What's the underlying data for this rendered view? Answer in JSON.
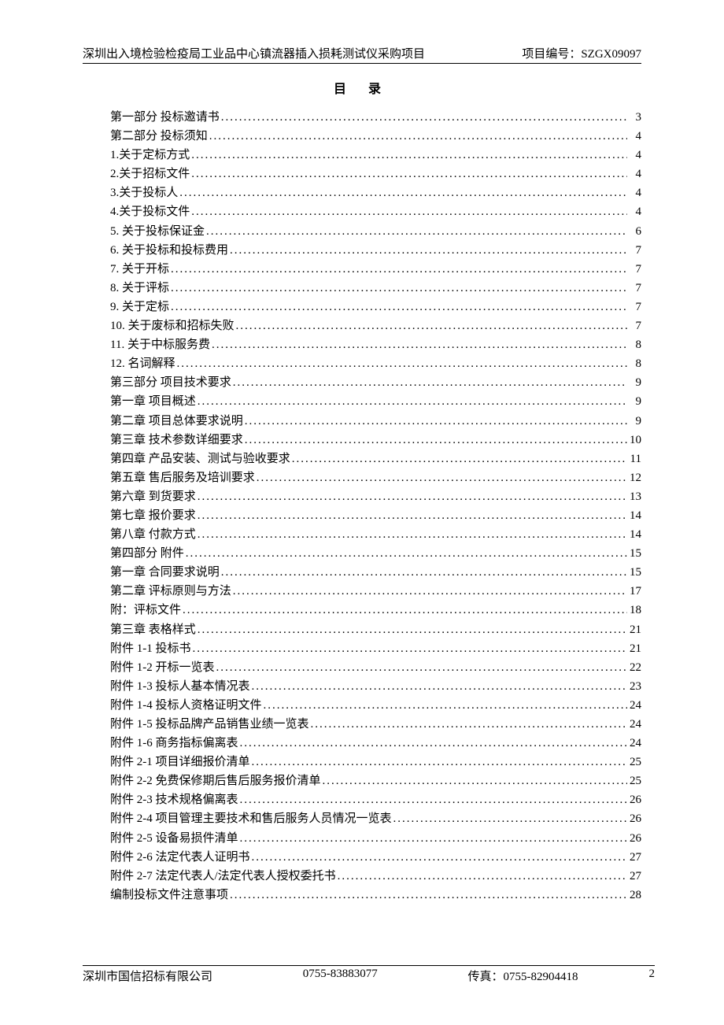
{
  "header": {
    "left": "深圳出入境检验检疫局工业品中心镇流器插入损耗测试仪采购项目",
    "right_label": "项目编号：",
    "right_code": "SZGX09097"
  },
  "title": "目  录",
  "toc": [
    {
      "label": "第一部分 投标邀请书",
      "page": "3"
    },
    {
      "label": "第二部分 投标须知",
      "page": "4"
    },
    {
      "label": "1.关于定标方式",
      "page": "4"
    },
    {
      "label": "2.关于招标文件",
      "page": "4"
    },
    {
      "label": "3.关于投标人",
      "page": "4"
    },
    {
      "label": "4.关于投标文件",
      "page": "4"
    },
    {
      "label": "5. 关于投标保证金",
      "page": "6"
    },
    {
      "label": "6. 关于投标和投标费用",
      "page": "7"
    },
    {
      "label": "7. 关于开标",
      "page": "7"
    },
    {
      "label": "8. 关于评标",
      "page": "7"
    },
    {
      "label": "9. 关于定标",
      "page": "7"
    },
    {
      "label": "10. 关于废标和招标失败",
      "page": "7"
    },
    {
      "label": "11. 关于中标服务费",
      "page": "8"
    },
    {
      "label": "12. 名词解释",
      "page": "8"
    },
    {
      "label": "第三部分  项目技术要求",
      "page": "9"
    },
    {
      "label": "第一章  项目概述",
      "page": "9"
    },
    {
      "label": "第二章  项目总体要求说明",
      "page": "9"
    },
    {
      "label": "第三章  技术参数详细要求",
      "page": "10"
    },
    {
      "label": "第四章  产品安装、测试与验收要求",
      "page": "11"
    },
    {
      "label": "第五章  售后服务及培训要求",
      "page": "12"
    },
    {
      "label": "第六章  到货要求",
      "page": "13"
    },
    {
      "label": "第七章  报价要求",
      "page": "14"
    },
    {
      "label": "第八章  付款方式",
      "page": "14"
    },
    {
      "label": "第四部分  附件",
      "page": "15"
    },
    {
      "label": "第一章  合同要求说明",
      "page": "15"
    },
    {
      "label": "第二章  评标原则与方法",
      "page": "17"
    },
    {
      "label": "附：评标文件",
      "page": "18"
    },
    {
      "label": "第三章  表格样式",
      "page": "21"
    },
    {
      "label": "附件 1-1 投标书",
      "page": "21"
    },
    {
      "label": "附件 1-2 开标一览表",
      "page": "22"
    },
    {
      "label": "附件 1-3 投标人基本情况表",
      "page": "23"
    },
    {
      "label": "附件 1-4 投标人资格证明文件",
      "page": "24"
    },
    {
      "label": "附件 1-5 投标品牌产品销售业绩一览表",
      "page": "24"
    },
    {
      "label": "附件 1-6 商务指标偏离表",
      "page": "24"
    },
    {
      "label": "附件 2-1 项目详细报价清单",
      "page": "25"
    },
    {
      "label": "附件 2-2 免费保修期后售后服务报价清单",
      "page": "25"
    },
    {
      "label": "附件 2-3 技术规格偏离表",
      "page": "26"
    },
    {
      "label": "附件 2-4 项目管理主要技术和售后服务人员情况一览表",
      "page": "26"
    },
    {
      "label": "附件 2-5 设备易损件清单",
      "page": "26"
    },
    {
      "label": "附件 2-6 法定代表人证明书",
      "page": "27"
    },
    {
      "label": "附件 2-7 法定代表人/法定代表人授权委托书",
      "page": "27"
    },
    {
      "label": "编制投标文件注意事项",
      "page": "28"
    }
  ],
  "footer": {
    "company": "深圳市国信招标有限公司",
    "phone": "0755-83883077",
    "fax_label": "传真：",
    "fax": "0755-82904418",
    "page": "2"
  }
}
